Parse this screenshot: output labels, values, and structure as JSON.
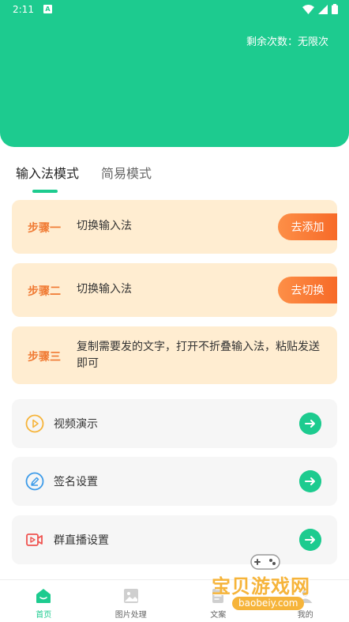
{
  "status_bar": {
    "time": "2:11",
    "notification_letter": "A"
  },
  "header": {
    "remaining": "剩余次数：无限次"
  },
  "tabs": [
    {
      "label": "输入法模式",
      "active": true
    },
    {
      "label": "简易模式",
      "active": false
    }
  ],
  "steps": [
    {
      "label": "步骤一",
      "text": "切换输入法",
      "button": "去添加"
    },
    {
      "label": "步骤二",
      "text": "切换输入法",
      "button": "去切换"
    },
    {
      "label": "步骤三",
      "text": "复制需要发的文字，打开不折叠输入法，粘贴发送即可"
    }
  ],
  "menu": [
    {
      "label": "视频演示",
      "icon": "play-circle-icon"
    },
    {
      "label": "签名设置",
      "icon": "pen-circle-icon"
    },
    {
      "label": "群直播设置",
      "icon": "live-video-icon"
    }
  ],
  "bottom_nav": [
    {
      "label": "首页",
      "icon": "home-icon",
      "active": true
    },
    {
      "label": "图片处理",
      "icon": "image-icon",
      "active": false
    },
    {
      "label": "文案",
      "icon": "document-icon",
      "active": false
    },
    {
      "label": "我的",
      "icon": "user-icon",
      "active": false
    }
  ],
  "watermark": {
    "text": "宝贝游戏网",
    "url": "baobeiy.com"
  },
  "colors": {
    "primary": "#1dcb8f",
    "step_bg": "#ffedd1",
    "step_accent": "#f07a33",
    "button_gradient_start": "#fd8f47",
    "button_gradient_end": "#f76a28"
  }
}
